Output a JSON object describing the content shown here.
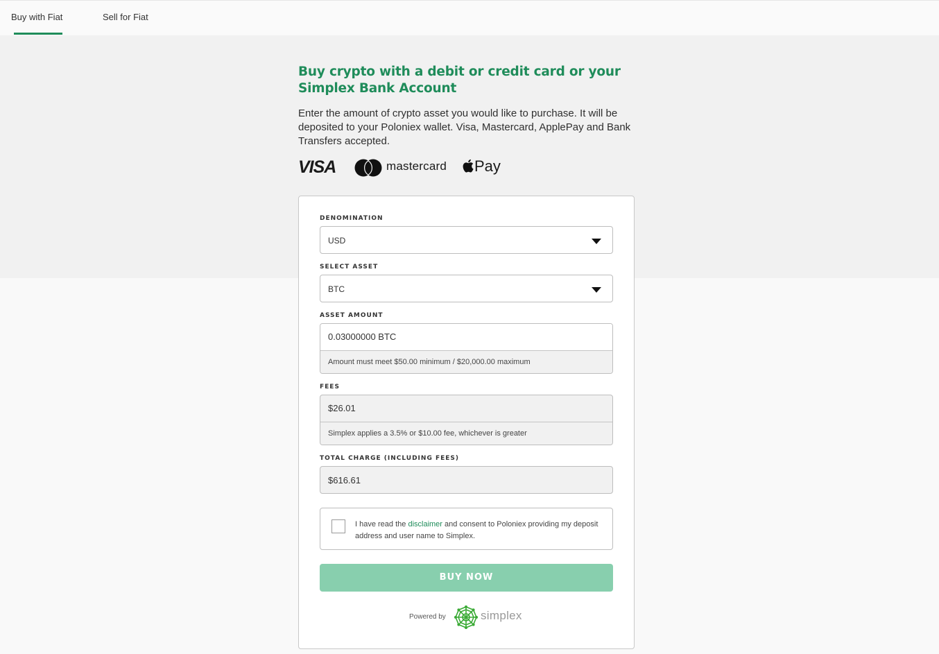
{
  "tabs": [
    {
      "label": "Buy with Fiat",
      "active": true
    },
    {
      "label": "Sell for Fiat",
      "active": false
    }
  ],
  "hero": {
    "headline": "Buy crypto with a debit or credit card or your Simplex Bank Account",
    "description": "Enter the amount of crypto asset you would like to purchase. It will be deposited to your Poloniex wallet. Visa, Mastercard, ApplePay and Bank Transfers accepted.",
    "payment_logos": {
      "visa": "VISA",
      "mastercard": "mastercard",
      "applepay": "Pay"
    }
  },
  "form": {
    "denomination": {
      "label": "DENOMINATION",
      "value": "USD"
    },
    "asset": {
      "label": "SELECT ASSET",
      "value": "BTC"
    },
    "amount": {
      "label": "ASSET AMOUNT",
      "value": "0.03000000 BTC",
      "hint": "Amount must meet $50.00 minimum / $20,000.00 maximum"
    },
    "fees": {
      "label": "FEES",
      "value": "$26.01",
      "hint": "Simplex applies a 3.5% or $10.00 fee, whichever is greater"
    },
    "total": {
      "label": "TOTAL CHARGE (INCLUDING FEES)",
      "value": "$616.61"
    },
    "consent": {
      "prefix": "I have read the ",
      "link": "disclaimer",
      "suffix": " and consent to Poloniex providing my deposit address and user name to Simplex.",
      "checked": false
    },
    "buy_button": "BUY NOW",
    "powered_by": "Powered by",
    "provider": "simplex"
  },
  "colors": {
    "accent": "#1f8c5a",
    "button_disabled": "#88cfae",
    "simplex_green": "#3aaa35"
  }
}
